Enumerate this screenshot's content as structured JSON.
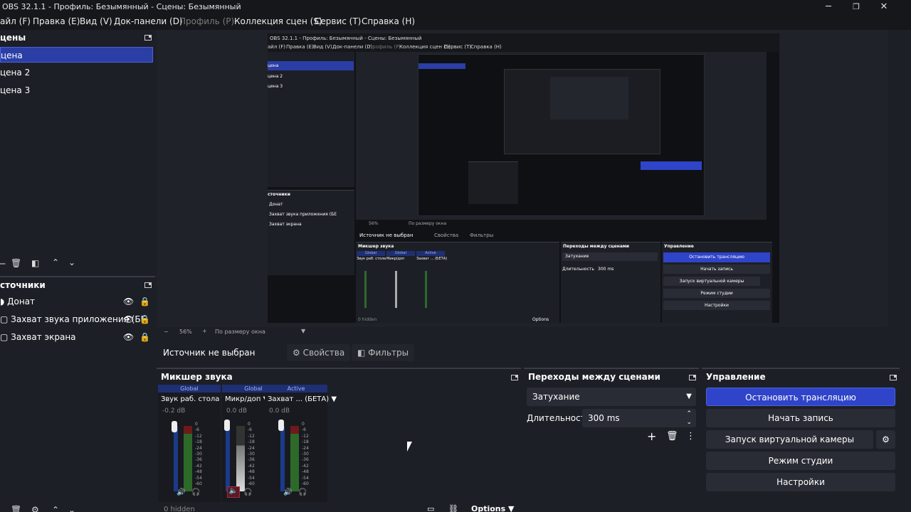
{
  "window": {
    "title": "OBS 32.1.1 - Профиль: Безымянный - Сцены: Безымянный",
    "minimize": "─",
    "maximize": "❐",
    "close": "✕"
  },
  "menu": [
    "айл (F)",
    "Правка (E)",
    "Вид (V)",
    "Док-панели (D)",
    "Профиль (P)",
    "Коллекция сцен (S)",
    "Сервис (T)",
    "Справка (H)"
  ],
  "scenes": {
    "title": "цены",
    "items": [
      "цена",
      "цена 2",
      "цена 3"
    ]
  },
  "sources": {
    "title": "сточники",
    "items": [
      "Донат",
      "Захват звука приложения (БЕ",
      "Захват экрана"
    ]
  },
  "preview_bar": {
    "zoom": "56%",
    "fit": "По размеру окна"
  },
  "source_bar": {
    "label": "Источник не выбран",
    "properties": "Свойства",
    "filters": "Фильтры"
  },
  "mixer": {
    "title": "Микшер звука",
    "channels": [
      {
        "head": "Global",
        "name": "Звук раб. стола",
        "db": "-0.2 dB",
        "level": 0.88,
        "muted": false
      },
      {
        "head": "Global",
        "name": "Микр/доп",
        "db": "0.0 dB",
        "level": 0.7,
        "muted": true
      },
      {
        "head": "Active",
        "name": "Захват ... (БЕТА)",
        "db": "0.0 dB",
        "level": 0.88,
        "muted": false
      }
    ],
    "ticks": [
      "0",
      "-6",
      "-12",
      "-18",
      "-24",
      "-30",
      "-36",
      "-42",
      "-48",
      "-54",
      "-60"
    ],
    "hidden": "0 hidden",
    "options": "Options"
  },
  "transitions": {
    "title": "Переходы между сценами",
    "selected": "Затухание",
    "duration_label": "Длительность",
    "duration_value": "300 ms"
  },
  "controls": {
    "title": "Управление",
    "stop_stream": "Остановить трансляцию",
    "start_record": "Начать запись",
    "virtual_cam": "Запуск виртуальной камеры",
    "studio_mode": "Режим студии",
    "settings": "Настройки"
  },
  "nested": {
    "title": "OBS 32.1.1 - Профиль: Безымянный - Сцены: Безымянный",
    "menu": [
      "айл (F)",
      "Правка (E)",
      "Вид (V)",
      "Док-панели (D)",
      "Профиль (P)",
      "Коллекция сцен (S)",
      "Сервис (T)",
      "Справка (H)"
    ],
    "scenes": [
      "цена",
      "цена 2",
      "цена 3"
    ],
    "sources_title": "сточники",
    "sources": [
      "Донат",
      "Захват звука приложения (БЕ",
      "Захват экрана"
    ],
    "no_source": "Источник не выбран",
    "properties": "Свойства",
    "filters": "Фильтры",
    "mixer_title": "Микшер звука",
    "transitions_title": "Переходы между сценами",
    "fade": "Затухание",
    "duration": "Длительность",
    "duration_value": "300 ms",
    "controls_title": "Управление",
    "stop": "Остановить трансляцию",
    "record": "Начать запись",
    "vcam": "Запуск виртуальной камеры",
    "studio": "Режим студии",
    "settings": "Настройки",
    "zoom": "56%",
    "fit": "По размеру окна",
    "heads": [
      "Global",
      "Global",
      "Active"
    ],
    "chan_names": [
      "Звук раб. стола",
      "Микр/доп",
      "Захват ... (БЕТА)"
    ],
    "hidden": "0 hidden",
    "options": "Options"
  }
}
